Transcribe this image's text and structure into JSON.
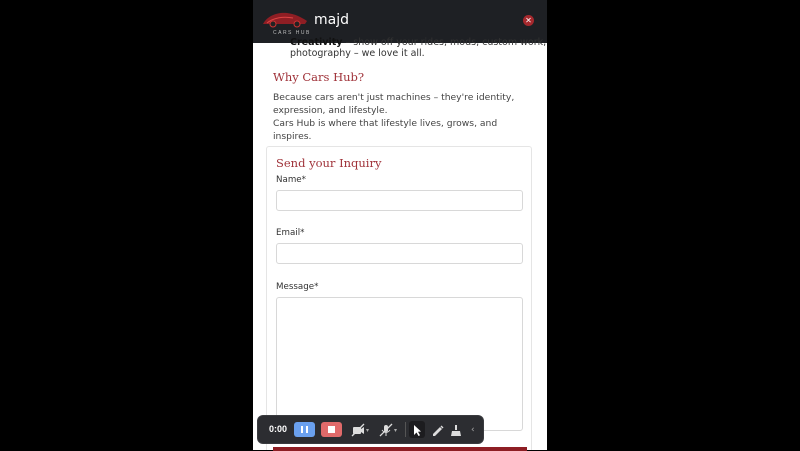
{
  "header": {
    "logo_text": "CARS HUB",
    "brand_name": "majd",
    "close_icon": "close-icon",
    "accent_color": "#a5282d"
  },
  "content": {
    "cut_line_bold": "Creativity",
    "cut_line_rest": " – show off your rides, mods, custom work, or",
    "cut_line2": "photography – we love it all.",
    "section_title": "Why Cars Hub?",
    "para1": "Because cars aren't just machines – they're identity, expression, and lifestyle.",
    "para2": "Cars Hub is where that lifestyle lives, grows, and inspires."
  },
  "form": {
    "title": "Send your Inquiry",
    "name_label": "Name*",
    "email_label": "Email*",
    "message_label": "Message*",
    "name_value": "",
    "email_value": "",
    "message_value": ""
  },
  "recorder": {
    "time": "0:00",
    "icons": [
      "pause-icon",
      "stop-icon",
      "camera-off-icon",
      "mic-off-icon",
      "cursor-icon",
      "pen-icon",
      "eraser-icon",
      "collapse-icon"
    ]
  }
}
